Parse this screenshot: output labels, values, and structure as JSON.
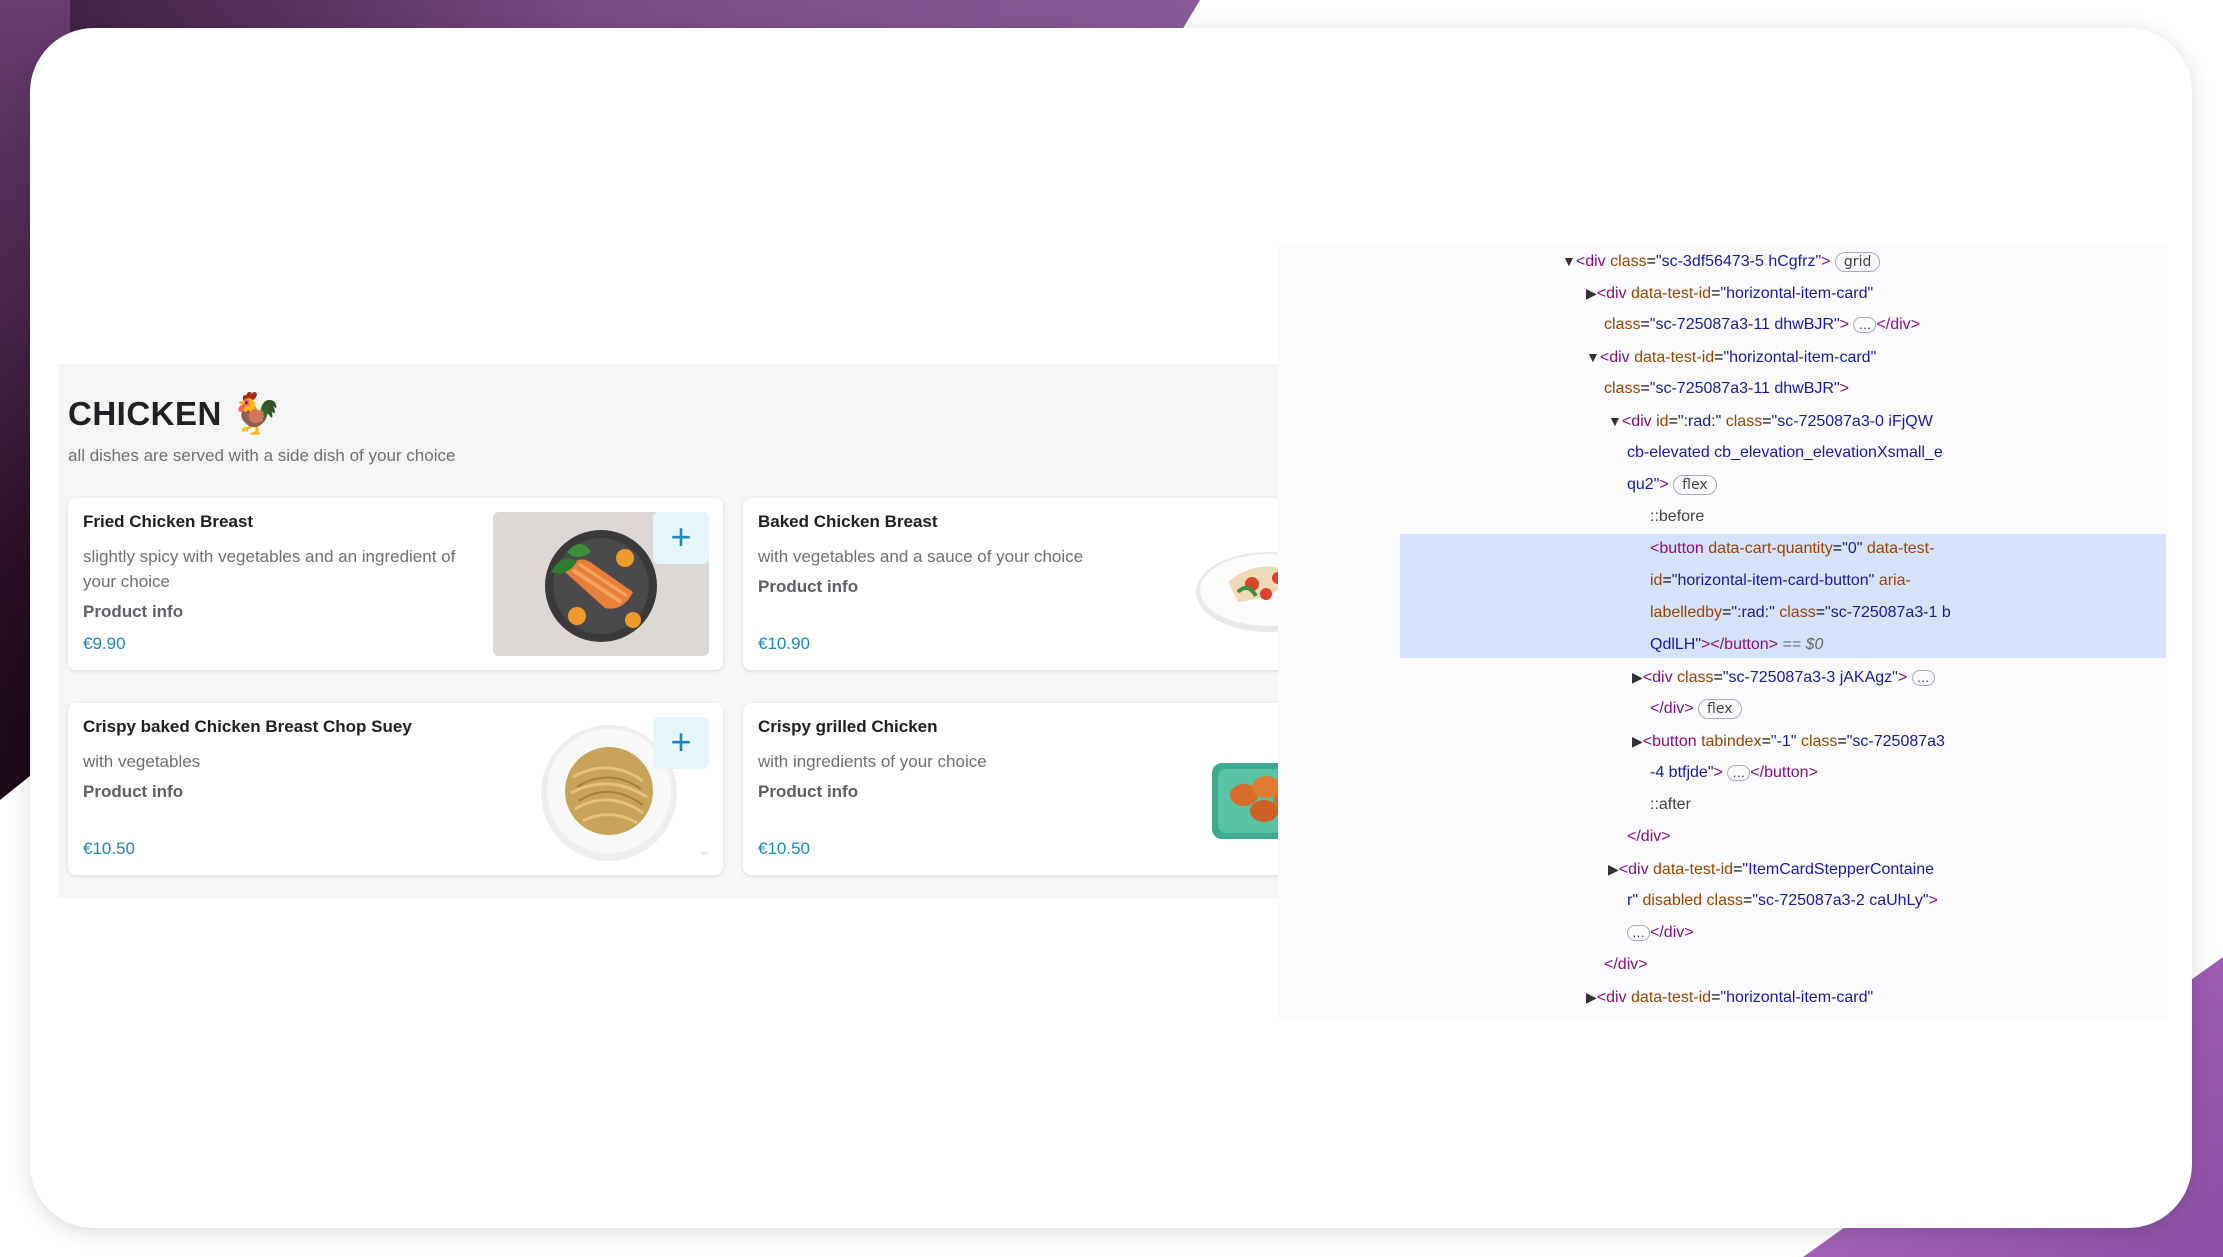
{
  "menu": {
    "title": "CHICKEN",
    "emoji": "🐓",
    "subtitle": "all dishes are served with a side dish of your choice",
    "add_symbol": "+",
    "items": [
      {
        "name": "Fried Chicken Breast",
        "desc": "slightly spicy with vegetables and an ingredient of your choice",
        "info": "Product info",
        "price": "€9.90"
      },
      {
        "name": "Baked Chicken Breast",
        "desc": "with vegetables and a sauce of your choice",
        "info": "Product info",
        "price": "€10.90"
      },
      {
        "name": "Crispy baked Chicken Breast Chop Suey",
        "desc": "with vegetables",
        "info": "Product info",
        "price": "€10.50"
      },
      {
        "name": "Crispy grilled Chicken",
        "desc": "with ingredients of your choice",
        "info": "Product info",
        "price": "€10.50"
      }
    ]
  },
  "devtools": {
    "l1_open": "<div ",
    "l1_attr": "class",
    "l1_val": "\"sc-3df56473-5 hCgfrz\"",
    "l1_close": ">",
    "l1_pill": "grid",
    "l2_open": "<div ",
    "l2_attr": "data-test-id",
    "l2_val": "\"horizontal-item-card\"",
    "l3_attr": "class",
    "l3_val": "\"sc-725087a3-11 dhwBJR\"",
    "l3_gt": ">",
    "l3_dots": "…",
    "l3_end": "</div>",
    "l4_open": "<div ",
    "l4_attr": "data-test-id",
    "l4_val": "\"horizontal-item-card\"",
    "l5_attr": "class",
    "l5_val": "\"sc-725087a3-11 dhwBJR\"",
    "l5_gt": ">",
    "l6_open": "<div ",
    "l6_attr1": "id",
    "l6_val1": "\":rad:\"",
    "l6_attr2": "class",
    "l6_val2": "\"sc-725087a3-0 iFjQW",
    "l7_val": "cb-elevated cb_elevation_elevationXsmall_e",
    "l8_val": "qu2\"",
    "l8_gt": ">",
    "l8_pill": "flex",
    "l9": "::before",
    "l10_open": "<button ",
    "l10_attr1": "data-cart-quantity",
    "l10_val1": "\"0\"",
    "l10_attr2": "data-test-",
    "l11_attr": "id",
    "l11_val": "\"horizontal-item-card-button\"",
    "l11_attr2": "aria-",
    "l12_attr": "labelledby",
    "l12_val": "\":rad:\"",
    "l12_attr2": "class",
    "l12_val2": "\"sc-725087a3-1 b",
    "l13_val": "QdlLH\"",
    "l13_close": "></button>",
    "l13_eq": "== $0",
    "l14_open": "<div ",
    "l14_attr": "class",
    "l14_val": "\"sc-725087a3-3 jAKAgz\"",
    "l14_gt": ">",
    "l14_dots": "…",
    "l15_end": "</div>",
    "l15_pill": "flex",
    "l16_open": "<button ",
    "l16_attr1": "tabindex",
    "l16_val1": "\"-1\"",
    "l16_attr2": "class",
    "l16_val2": "\"sc-725087a3",
    "l17_val": "-4 btfjde\"",
    "l17_gt": ">",
    "l17_dots": "…",
    "l17_end": "</button>",
    "l18": "::after",
    "l19": "</div>",
    "l20_open": "<div ",
    "l20_attr": "data-test-id",
    "l20_val": "\"ItemCardStepperContaine",
    "l21_val": "r\"",
    "l21_attr": "disabled",
    "l21_attr2": "class",
    "l21_val2": "\"sc-725087a3-2 caUhLy\"",
    "l21_gt": ">",
    "l22_dots": "…",
    "l22_end": "</div>",
    "l23": "</div>",
    "l24_open": "<div ",
    "l24_attr": "data-test-id",
    "l24_val": "\"horizontal-item-card\""
  }
}
